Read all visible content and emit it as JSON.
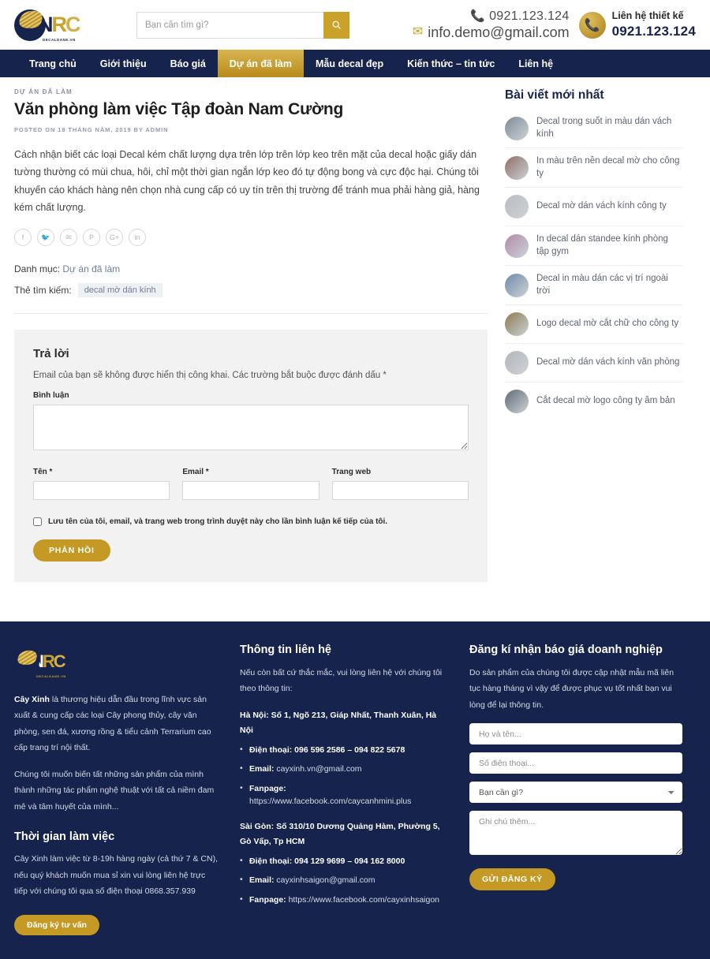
{
  "colors": {
    "navy": "#16234d",
    "gold": "#c9a227",
    "gold_dark": "#b88c1c",
    "muted": "#8f9bb3"
  },
  "header": {
    "logo": {
      "n": "N",
      "r": "R",
      "c": "C",
      "sub": "DECALDANE.VN"
    },
    "search": {
      "placeholder": "Bạn cần tìm gì?",
      "value": "",
      "button_icon": "search-icon"
    },
    "phone_top": "0921.123.124",
    "email": "info.demo@gmail.com",
    "cta_label": "Liên hệ thiết kế",
    "cta_phone": "0921.123.124"
  },
  "nav": {
    "items": [
      {
        "label": "Trang chủ",
        "active": false
      },
      {
        "label": "Giới thiệu",
        "active": false
      },
      {
        "label": "Báo giá",
        "active": false
      },
      {
        "label": "Dự án đã làm",
        "active": true
      },
      {
        "label": "Mẫu decal đẹp",
        "active": false
      },
      {
        "label": "Kiến thức – tin tức",
        "active": false
      },
      {
        "label": "Liên hệ",
        "active": false
      }
    ]
  },
  "post": {
    "category_label": "DỰ ÁN ĐÃ LÀM",
    "title": "Văn phòng làm việc Tập đoàn Nam Cường",
    "meta": "POSTED ON 18 THÁNG NĂM, 2019 BY ADMIN",
    "body": "Cách nhận biết các loại Decal kém chất lượng dựa trên lớp trên lớp keo trên mặt của decal hoặc giấy dán tường thường có mùi chua, hôi, chỉ một thời gian ngắn lớp keo đó tự động bong và cực độc hại. Chúng tôi khuyến cáo khách hàng nên chọn nhà cung cấp có uy tín trên thị trường để tránh mua phải hàng giả, hàng kém chất lượng.",
    "social": [
      {
        "name": "facebook-icon",
        "glyph": "f"
      },
      {
        "name": "twitter-icon",
        "glyph": "🐦"
      },
      {
        "name": "email-icon",
        "glyph": "✉"
      },
      {
        "name": "pinterest-icon",
        "glyph": "P"
      },
      {
        "name": "google-plus-icon",
        "glyph": "G+"
      },
      {
        "name": "linkedin-icon",
        "glyph": "in"
      }
    ],
    "category_prefix": "Danh mục:",
    "category_link": "Dự án đã làm",
    "tags_prefix": "Thẻ tìm kiếm:",
    "tag": "decal mờ dán kính"
  },
  "comment_form": {
    "heading": "Trả lời",
    "notice": "Email của bạn sẽ không được hiển thị công khai. Các trường bắt buộc được đánh dấu *",
    "comment_label": "Bình luận",
    "comment_value": "",
    "name_label": "Tên *",
    "name_value": "",
    "email_label": "Email *",
    "email_value": "",
    "website_label": "Trang web",
    "website_value": "",
    "save_label": "Lưu tên của tôi, email, và trang web trong trình duyệt này cho lần bình luận kế tiếp của tôi.",
    "submit_label": "PHẢN HỒI"
  },
  "sidebar": {
    "heading": "Bài viết mới nhất",
    "posts": [
      {
        "title": "Decal trong suốt in màu dán vách kính",
        "thumb": "thumbnail-glass-wall"
      },
      {
        "title": "In màu trên nền decal mờ cho công ty",
        "thumb": "thumbnail-color-print"
      },
      {
        "title": "Decal mờ dán vách kính công ty",
        "thumb": "thumbnail-frosted-glass"
      },
      {
        "title": "In decal dán standee kính phòng tập gym",
        "thumb": "thumbnail-gym-standee"
      },
      {
        "title": "Decal in màu dán các vị trí ngoài trời",
        "thumb": "thumbnail-outdoor"
      },
      {
        "title": "Logo decal mờ cắt chữ cho công ty",
        "thumb": "thumbnail-logo-cut"
      },
      {
        "title": "Decal mờ dán vách kính văn phòng",
        "thumb": "thumbnail-office-glass"
      },
      {
        "title": "Cắt decal mờ logo công ty âm bản",
        "thumb": "thumbnail-negative-logo"
      }
    ]
  },
  "footer": {
    "col1": {
      "logo_sub": "DECALDANE.VN",
      "about_strong": "Cây Xinh",
      "about_rest": " là thương hiệu dẫn đầu trong lĩnh vực sản xuất & cung cấp các loại Cây phong thủy, cây văn phòng, sen đá, xương rồng & tiểu cảnh Terrarium cao cấp trang trí nội thất.",
      "about2": "Chúng tôi muốn biến tất những sản phẩm của mình thành những tác phẩm nghệ thuật với tất cả niềm đam mê và tâm huyết của mình...",
      "hours_heading": "Thời gian làm việc",
      "hours_text": "Cây Xinh làm việc từ 8-19h hàng ngày (cả thứ 7 & CN), nếu quý khách muốn mua sỉ xin vui lòng liên hệ trực tiếp với chúng tôi qua số điện thoại 0868.357.939",
      "button": "Đăng ký tư vấn"
    },
    "col2": {
      "heading": "Thông tin liên hệ",
      "intro": "Nếu còn bất cứ thắc mắc, vui lòng liên hệ với chúng tôi theo thông tin:",
      "hanoi_addr": "Hà Nội: Số 1, Ngõ 213, Giáp Nhất, Thanh Xuân, Hà Nội",
      "hanoi_items": [
        {
          "label": "Điện thoại:",
          "value": " 096 596 2586 – 094 822 5678",
          "bold_value": true
        },
        {
          "label": "Email:",
          "value": " cayxinh.vn@gmail.com",
          "bold_value": false
        },
        {
          "label": "Fanpage:",
          "value": " https://www.facebook.com/caycanhmini.plus",
          "bold_value": false
        }
      ],
      "saigon_addr": "Sài Gòn: Số 310/10 Dương Quảng Hàm, Phường 5, Gò Vấp, Tp HCM",
      "saigon_items": [
        {
          "label": "Điện thoại:",
          "value": " 094 129 9699 – 094 162 8000",
          "bold_value": true
        },
        {
          "label": "Email:",
          "value": " cayxinhsaigon@gmail.com",
          "bold_value": false
        },
        {
          "label": "Fanpage:",
          "value": " https://www.facebook.com/cayxinhsaigon",
          "bold_value": false
        }
      ]
    },
    "col3": {
      "heading": "Đăng kí nhận báo giá doanh nghiệp",
      "intro": "Do sản phẩm của chúng tôi được cập nhật mẫu mã liên tục hàng tháng vì vậy để được phục vụ tốt nhất bạn vui lòng để lại thông tin.",
      "name_placeholder": "Họ và tên...",
      "name_value": "",
      "phone_placeholder": "Số điện thoại...",
      "phone_value": "",
      "select_value": "Bạn cần gì?",
      "note_placeholder": "Ghi chú thêm...",
      "note_value": "",
      "submit_label": "GỬI ĐĂNG KÝ"
    }
  }
}
